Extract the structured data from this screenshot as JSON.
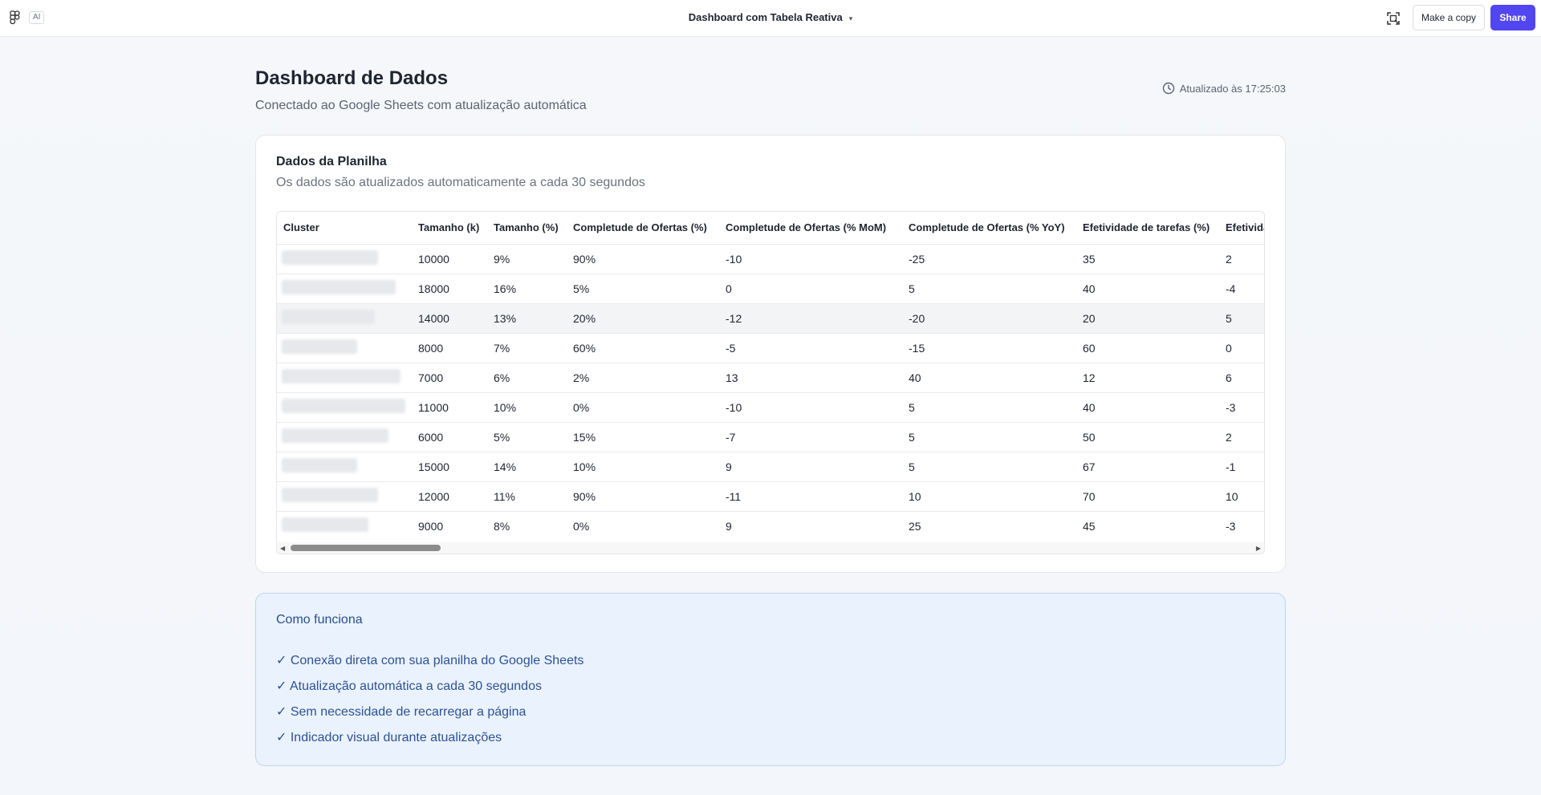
{
  "topbar": {
    "ai_label": "AI",
    "project_title": "Dashboard com Tabela Reativa",
    "make_copy_label": "Make a copy",
    "share_label": "Share"
  },
  "header": {
    "title": "Dashboard de Dados",
    "subtitle": "Conectado ao Google Sheets com atualização automática",
    "updated": "Atualizado às 17:25:03"
  },
  "card": {
    "title": "Dados da Planilha",
    "subtitle": "Os dados são atualizados automaticamente a cada 30 segundos",
    "columns": [
      "Cluster",
      "Tamanho (k)",
      "Tamanho (%)",
      "Completude de Ofertas (%)",
      "Completude de Ofertas (% MoM)",
      "Completude de Ofertas (% YoY)",
      "Efetividade de tarefas (%)",
      "Efetivida"
    ],
    "rows": [
      [
        "",
        "10000",
        "9%",
        "90%",
        "-10",
        "-25",
        "35",
        "2"
      ],
      [
        "",
        "18000",
        "16%",
        "5%",
        "0",
        "5",
        "40",
        "-4"
      ],
      [
        "",
        "14000",
        "13%",
        "20%",
        "-12",
        "-20",
        "20",
        "5"
      ],
      [
        "",
        "8000",
        "7%",
        "60%",
        "-5",
        "-15",
        "60",
        "0"
      ],
      [
        "",
        "7000",
        "6%",
        "2%",
        "13",
        "40",
        "12",
        "6"
      ],
      [
        "",
        "11000",
        "10%",
        "0%",
        "-10",
        "5",
        "40",
        "-3"
      ],
      [
        "",
        "6000",
        "5%",
        "15%",
        "-7",
        "5",
        "50",
        "2"
      ],
      [
        "",
        "15000",
        "14%",
        "10%",
        "9",
        "5",
        "67",
        "-1"
      ],
      [
        "",
        "12000",
        "11%",
        "90%",
        "-11",
        "10",
        "70",
        "10"
      ],
      [
        "",
        "9000",
        "8%",
        "0%",
        "9",
        "25",
        "45",
        "-3"
      ]
    ],
    "highlighted_row": 2
  },
  "info": {
    "title": "Como funciona",
    "items": [
      "✓ Conexão direta com sua planilha do Google Sheets",
      "✓ Atualização automática a cada 30 segundos",
      "✓ Sem necessidade de recarregar a página",
      "✓ Indicador visual durante atualizações"
    ]
  },
  "icons": {
    "logo": "figma-logo-icon",
    "inspect": "inspect-frame-icon",
    "clock": "clock-icon"
  },
  "colors": {
    "accent": "#5146f0",
    "info_bg": "#eaf2fd",
    "info_text": "#2d5294"
  }
}
